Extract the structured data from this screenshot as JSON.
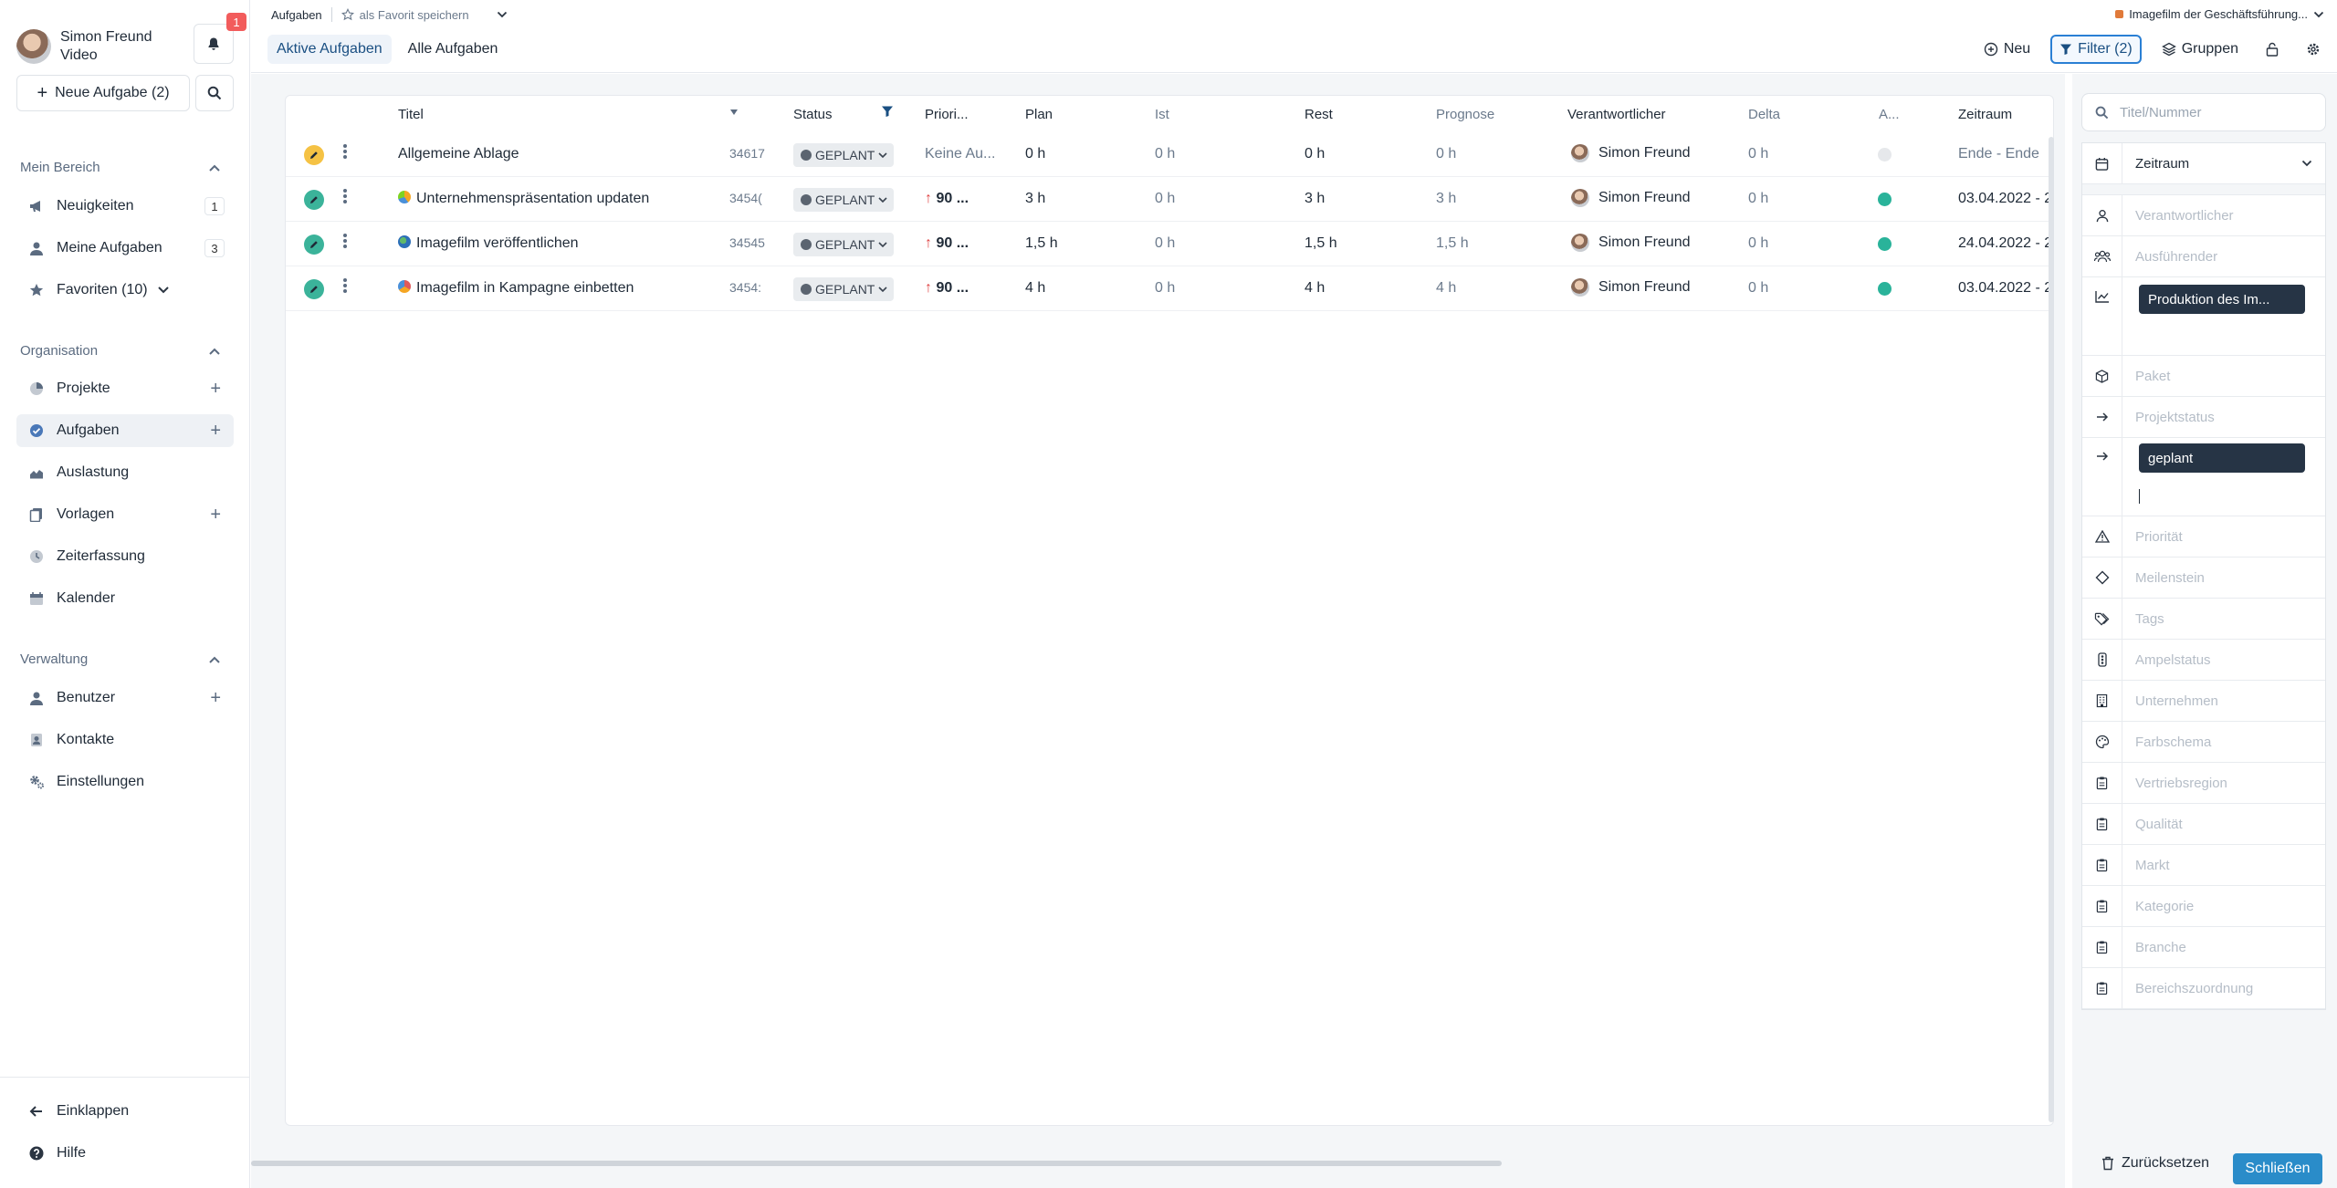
{
  "user": {
    "name": "Simon Freund",
    "role": "Video",
    "notification_count": "1"
  },
  "sidebar": {
    "new_task_label": "Neue Aufgabe (2)",
    "section_mine": "Mein Bereich",
    "mine_items": [
      {
        "label": "Neuigkeiten",
        "count": "1"
      },
      {
        "label": "Meine Aufgaben",
        "count": "3"
      },
      {
        "label": "Favoriten (10)"
      }
    ],
    "section_org": "Organisation",
    "org_items": [
      {
        "label": "Projekte"
      },
      {
        "label": "Aufgaben"
      },
      {
        "label": "Auslastung"
      },
      {
        "label": "Vorlagen"
      },
      {
        "label": "Zeiterfassung"
      },
      {
        "label": "Kalender"
      }
    ],
    "section_admin": "Verwaltung",
    "admin_items": [
      {
        "label": "Benutzer"
      },
      {
        "label": "Kontakte"
      },
      {
        "label": "Einstellungen"
      }
    ],
    "collapse_label": "Einklappen",
    "help_label": "Hilfe"
  },
  "topbar": {
    "breadcrumb": "Aufgaben",
    "favorite_label": "als Favorit speichern",
    "tabs": [
      "Aktive Aufgaben",
      "Alle Aufgaben"
    ],
    "project": "Imagefilm der Geschäftsführung...",
    "new_label": "Neu",
    "filter_label": "Filter (2)",
    "groups_label": "Gruppen"
  },
  "table": {
    "headers": {
      "title": "Titel",
      "status": "Status",
      "priority": "Priori...",
      "plan": "Plan",
      "ist": "Ist",
      "rest": "Rest",
      "prognose": "Prognose",
      "owner": "Verantwortlicher",
      "delta": "Delta",
      "a": "A...",
      "zeitraum": "Zeitraum"
    },
    "rows": [
      {
        "title": "Allgemeine Ablage",
        "number": "34617",
        "status": "GEPLANT",
        "priority": "Keine Au...",
        "plan": "0 h",
        "ist": "0 h",
        "rest": "0 h",
        "prognose": "0 h",
        "owner": "Simon Freund",
        "delta": "0 h",
        "zeitraum": "Ende - Ende"
      },
      {
        "title": "Unternehmenspräsentation updaten",
        "number": "3454(",
        "status": "GEPLANT",
        "priority": "90 ...",
        "plan": "3 h",
        "ist": "0 h",
        "rest": "3 h",
        "prognose": "3 h",
        "owner": "Simon Freund",
        "delta": "0 h",
        "zeitraum": "03.04.2022 - 2"
      },
      {
        "title": "Imagefilm veröffentlichen",
        "number": "34545",
        "status": "GEPLANT",
        "priority": "90 ...",
        "plan": "1,5 h",
        "ist": "0 h",
        "rest": "1,5 h",
        "prognose": "1,5 h",
        "owner": "Simon Freund",
        "delta": "0 h",
        "zeitraum": "24.04.2022 - 2"
      },
      {
        "title": "Imagefilm in Kampagne einbetten",
        "number": "3454:",
        "status": "GEPLANT",
        "priority": "90 ...",
        "plan": "4 h",
        "ist": "0 h",
        "rest": "4 h",
        "prognose": "4 h",
        "owner": "Simon Freund",
        "delta": "0 h",
        "zeitraum": "03.04.2022 - 2"
      }
    ]
  },
  "filter_panel": {
    "search_placeholder": "Titel/Nummer",
    "zeitraum": "Zeitraum",
    "fields": {
      "verantwortlicher": "Verantwortlicher",
      "ausfuehrender": "Ausführender",
      "projekt_chip": "Produktion des Im...",
      "paket": "Paket",
      "projektstatus": "Projektstatus",
      "status_chip": "geplant",
      "prioritaet": "Priorität",
      "meilenstein": "Meilenstein",
      "tags": "Tags",
      "ampelstatus": "Ampelstatus",
      "unternehmen": "Unternehmen",
      "farbschema": "Farbschema",
      "vertriebsregion": "Vertriebsregion",
      "qualitaet": "Qualität",
      "markt": "Markt",
      "kategorie": "Kategorie",
      "branche": "Branche",
      "bereichszuordnung": "Bereichszuordnung"
    },
    "reset_label": "Zurücksetzen",
    "close_label": "Schließen"
  }
}
